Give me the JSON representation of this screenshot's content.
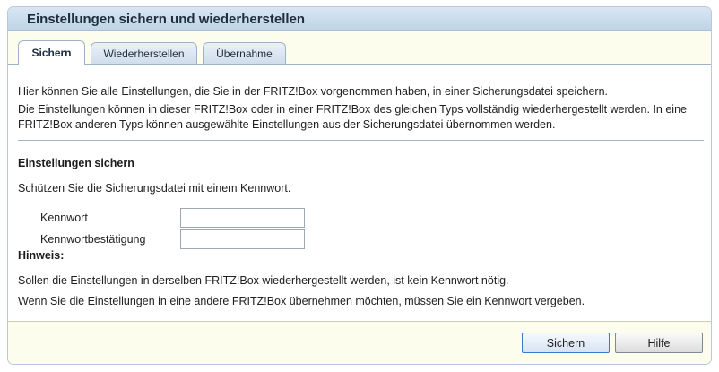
{
  "header": {
    "title": "Einstellungen sichern und wiederherstellen"
  },
  "tabs": [
    {
      "label": "Sichern",
      "active": true
    },
    {
      "label": "Wiederherstellen",
      "active": false
    },
    {
      "label": "Übernahme",
      "active": false
    }
  ],
  "content": {
    "intro_1": "Hier können Sie alle Einstellungen, die Sie in der FRITZ!Box vorgenommen haben, in einer Sicherungsdatei speichern.",
    "intro_2": "Die Einstellungen können in dieser FRITZ!Box oder in einer FRITZ!Box des gleichen Typs vollständig wiederhergestellt werden. In eine FRITZ!Box anderen Typs können ausgewählte Einstellungen aus der Sicherungsdatei übernommen werden.",
    "section_title": "Einstellungen sichern",
    "protect_text": "Schützen Sie die Sicherungsdatei mit einem Kennwort.",
    "password_label": "Kennwort",
    "password_value": "",
    "password_confirm_label": "Kennwortbestätigung",
    "password_confirm_value": "",
    "note_title": "Hinweis:",
    "note_1": "Sollen die Einstellungen in derselben FRITZ!Box wiederhergestellt werden, ist kein Kennwort nötig.",
    "note_2": "Wenn Sie die Einstellungen in eine andere FRITZ!Box übernehmen möchten, müssen Sie ein Kennwort vergeben."
  },
  "footer": {
    "save_label": "Sichern",
    "help_label": "Hilfe"
  },
  "colors": {
    "header_bg": "#c8dbee",
    "panel_bg": "#fdfded",
    "primary_border": "#3a79c8"
  }
}
